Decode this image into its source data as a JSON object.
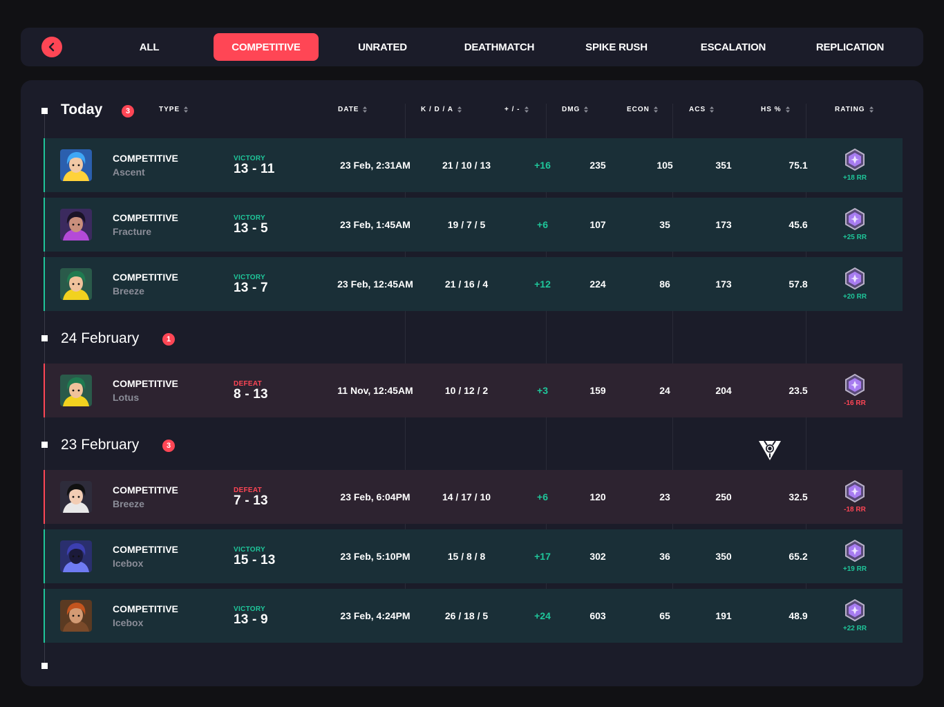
{
  "nav": {
    "tabs": [
      "ALL",
      "COMPETITIVE",
      "UNRATED",
      "DEATHMATCH",
      "SPIKE RUSH",
      "ESCALATION",
      "REPLICATION"
    ],
    "active": "COMPETITIVE"
  },
  "columns": {
    "type": "TYPE",
    "date": "DATE",
    "kda": "K / D / A",
    "plusminus": "+ / -",
    "dmg": "DMG",
    "econ": "ECON",
    "acs": "ACS",
    "hs": "HS %",
    "rating": "RATING"
  },
  "groups": [
    {
      "title": "Today",
      "count": "3",
      "matches": [
        {
          "mode": "COMPETITIVE",
          "map": "Ascent",
          "result": "VICTORY",
          "score": "13 - 11",
          "date": "23 Feb, 2:31AM",
          "kda": "21 / 10 / 13",
          "pm": "+16",
          "dmg": "235",
          "econ": "105",
          "acs": "351",
          "hs": "75.1",
          "rr": "+18 RR",
          "agent": "blue-hair"
        },
        {
          "mode": "COMPETITIVE",
          "map": "Fracture",
          "result": "VICTORY",
          "score": "13 - 5",
          "date": "23 Feb, 1:45AM",
          "kda": "19 / 7 / 5",
          "pm": "+6",
          "dmg": "107",
          "econ": "35",
          "acs": "173",
          "hs": "45.6",
          "rr": "+25 RR",
          "agent": "dark-hair"
        },
        {
          "mode": "COMPETITIVE",
          "map": "Breeze",
          "result": "VICTORY",
          "score": "13 - 7",
          "date": "23 Feb, 12:45AM",
          "kda": "21 / 16 / 4",
          "pm": "+12",
          "dmg": "224",
          "econ": "86",
          "acs": "173",
          "hs": "57.8",
          "rr": "+20 RR",
          "agent": "green-beanie"
        }
      ]
    },
    {
      "title": "24 February",
      "count": "1",
      "matches": [
        {
          "mode": "COMPETITIVE",
          "map": "Lotus",
          "result": "DEFEAT",
          "score": "8 - 13",
          "date": "11 Nov, 12:45AM",
          "kda": "10 / 12 / 2",
          "pm": "+3",
          "dmg": "159",
          "econ": "24",
          "acs": "204",
          "hs": "23.5",
          "rr": "-16 RR",
          "agent": "green-beanie"
        }
      ]
    },
    {
      "title": "23 February",
      "count": "3",
      "matches": [
        {
          "mode": "COMPETITIVE",
          "map": "Breeze",
          "result": "DEFEAT",
          "score": "7 - 13",
          "date": "23 Feb, 6:04PM",
          "kda": "14 / 17 / 10",
          "pm": "+6",
          "dmg": "120",
          "econ": "23",
          "acs": "250",
          "hs": "32.5",
          "rr": "-18 RR",
          "agent": "black-hair"
        },
        {
          "mode": "COMPETITIVE",
          "map": "Icebox",
          "result": "VICTORY",
          "score": "15 - 13",
          "date": "23 Feb, 5:10PM",
          "kda": "15 / 8 / 8",
          "pm": "+17",
          "dmg": "302",
          "econ": "36",
          "acs": "350",
          "hs": "65.2",
          "rr": "+19 RR",
          "agent": "hooded"
        },
        {
          "mode": "COMPETITIVE",
          "map": "Icebox",
          "result": "VICTORY",
          "score": "13 - 9",
          "date": "23 Feb, 4:24PM",
          "kda": "26 / 18 / 5",
          "pm": "+24",
          "dmg": "603",
          "econ": "65",
          "acs": "191",
          "hs": "48.9",
          "rr": "+22 RR",
          "agent": "beret"
        }
      ]
    }
  ],
  "colors": {
    "accent": "#ff4655",
    "win": "#1fc69a",
    "loss": "#ff4655",
    "win_row": "#1a2f37",
    "loss_row": "#2d2330",
    "panel": "#1b1c29",
    "background": "#111114",
    "rank_icon": "#a77cf0"
  }
}
